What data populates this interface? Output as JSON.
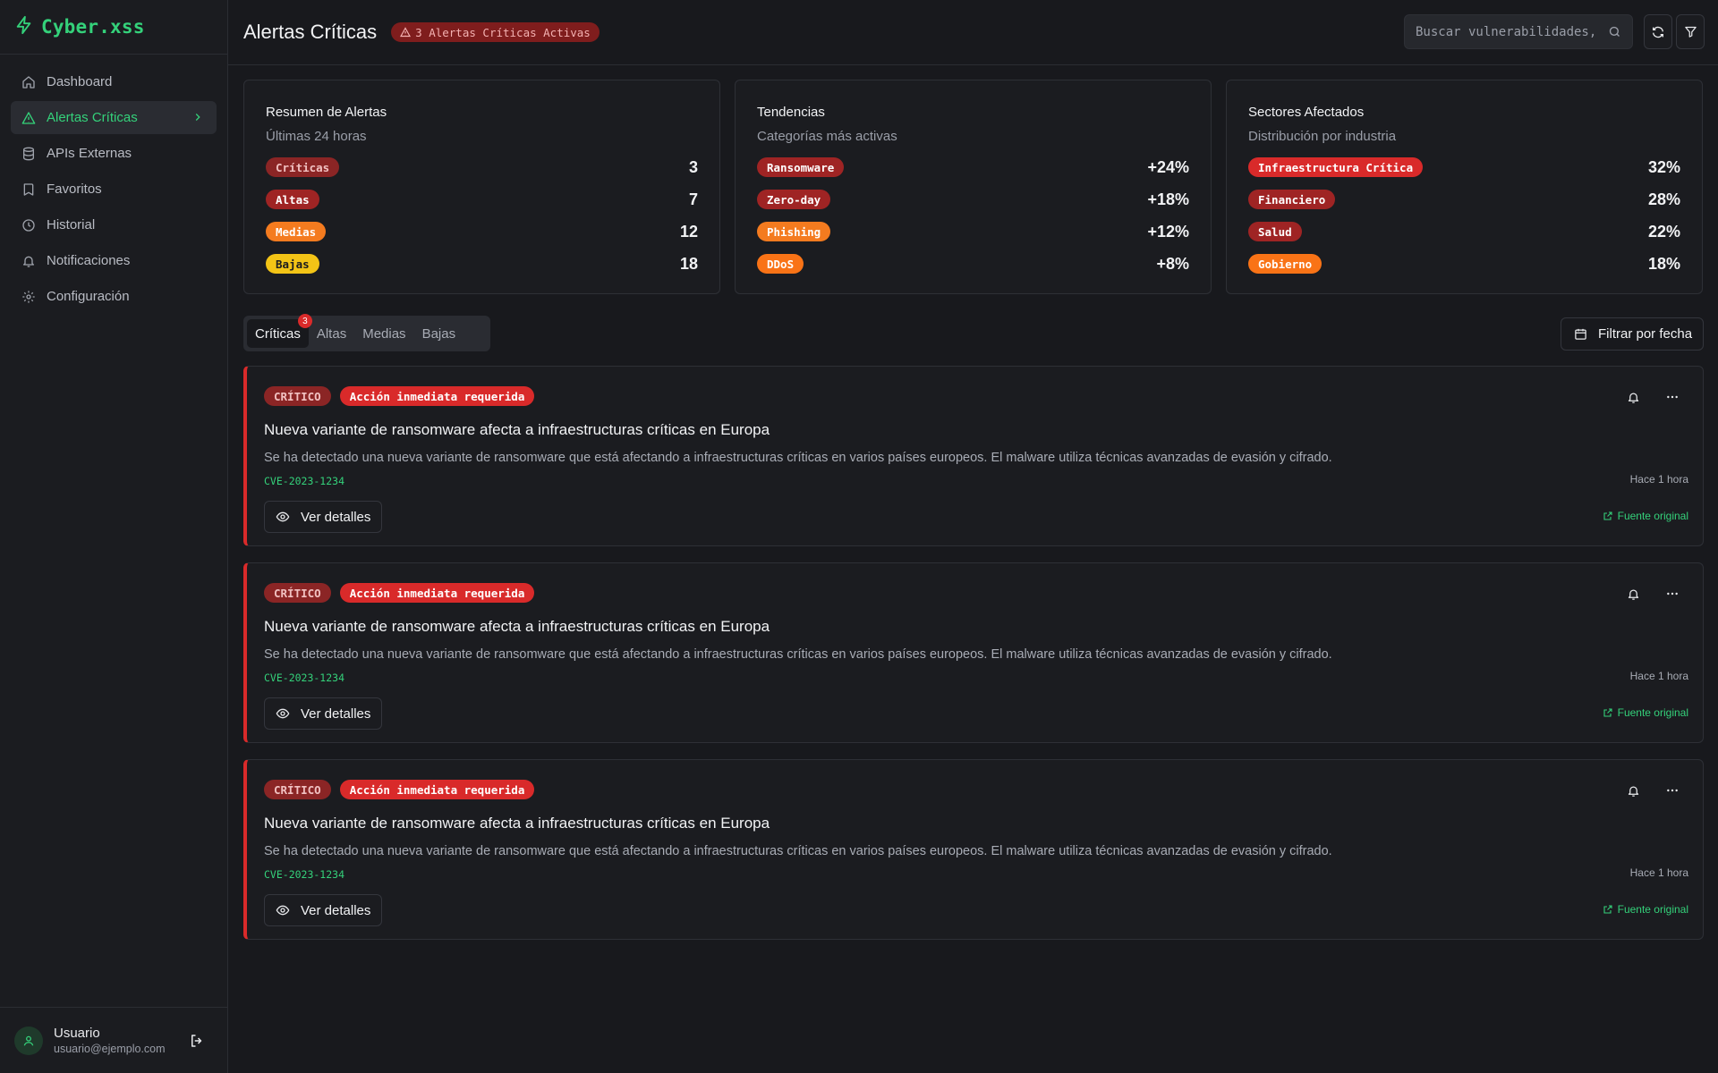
{
  "app": {
    "brand": "Cyber.xss"
  },
  "sidebar": {
    "items": [
      {
        "label": "Dashboard",
        "icon": "home-icon"
      },
      {
        "label": "Alertas Críticas",
        "icon": "warning-icon",
        "active": true
      },
      {
        "label": "APIs Externas",
        "icon": "database-icon"
      },
      {
        "label": "Favoritos",
        "icon": "bookmark-icon"
      },
      {
        "label": "Historial",
        "icon": "clock-icon"
      },
      {
        "label": "Notificaciones",
        "icon": "bell-icon"
      },
      {
        "label": "Configuración",
        "icon": "gear-icon"
      }
    ],
    "user": {
      "name": "Usuario",
      "email": "usuario@ejemplo.com"
    }
  },
  "header": {
    "title": "Alertas Críticas",
    "alert_pill": "3 Alertas Críticas Activas",
    "search_placeholder": "Buscar vulnerabilidades, CVEs..."
  },
  "cards": [
    {
      "title": "Resumen de Alertas",
      "subtitle": "Últimas 24 horas",
      "rows": [
        {
          "label": "Críticas",
          "value": "3"
        },
        {
          "label": "Altas",
          "value": "7"
        },
        {
          "label": "Medias",
          "value": "12"
        },
        {
          "label": "Bajas",
          "value": "18"
        }
      ]
    },
    {
      "title": "Tendencias",
      "subtitle": "Categorías más activas",
      "rows": [
        {
          "label": "Ransomware",
          "value": "+24%"
        },
        {
          "label": "Zero-day",
          "value": "+18%"
        },
        {
          "label": "Phishing",
          "value": "+12%"
        },
        {
          "label": "DDoS",
          "value": "+8%"
        }
      ]
    },
    {
      "title": "Sectores Afectados",
      "subtitle": "Distribución por industria",
      "rows": [
        {
          "label": "Infraestructura Crítica",
          "value": "32%"
        },
        {
          "label": "Financiero",
          "value": "28%"
        },
        {
          "label": "Salud",
          "value": "22%"
        },
        {
          "label": "Gobierno",
          "value": "18%"
        }
      ]
    }
  ],
  "tabs": [
    {
      "label": "Críticas",
      "badge": "3",
      "active": true
    },
    {
      "label": "Altas"
    },
    {
      "label": "Medias"
    },
    {
      "label": "Bajas"
    }
  ],
  "date_filter": "Filtrar por fecha",
  "alerts": [
    {
      "severity": "CRÍTICO",
      "action": "Acción inmediata requerida",
      "title": "Nueva variante de ransomware afecta a infraestructuras críticas en Europa",
      "description": "Se ha detectado una nueva variante de ransomware que está afectando a infraestructuras críticas en varios países europeos. El malware utiliza técnicas avanzadas de evasión y cifrado.",
      "cve": "CVE-2023-1234",
      "time": "Hace 1 hora",
      "details_label": "Ver detalles",
      "source_label": "Fuente original"
    },
    {
      "severity": "CRÍTICO",
      "action": "Acción inmediata requerida",
      "title": "Nueva variante de ransomware afecta a infraestructuras críticas en Europa",
      "description": "Se ha detectado una nueva variante de ransomware que está afectando a infraestructuras críticas en varios países europeos. El malware utiliza técnicas avanzadas de evasión y cifrado.",
      "cve": "CVE-2023-1234",
      "time": "Hace 1 hora",
      "details_label": "Ver detalles",
      "source_label": "Fuente original"
    },
    {
      "severity": "CRÍTICO",
      "action": "Acción inmediata requerida",
      "title": "Nueva variante de ransomware afecta a infraestructuras críticas en Europa",
      "description": "Se ha detectado una nueva variante de ransomware que está afectando a infraestructuras críticas en varios países europeos. El malware utiliza técnicas avanzadas de evasión y cifrado.",
      "cve": "CVE-2023-1234",
      "time": "Hace 1 hora",
      "details_label": "Ver detalles",
      "source_label": "Fuente original"
    }
  ],
  "colors": {
    "accent": "#34d17a",
    "critical": "#d92a2a",
    "background": "#18191d"
  }
}
